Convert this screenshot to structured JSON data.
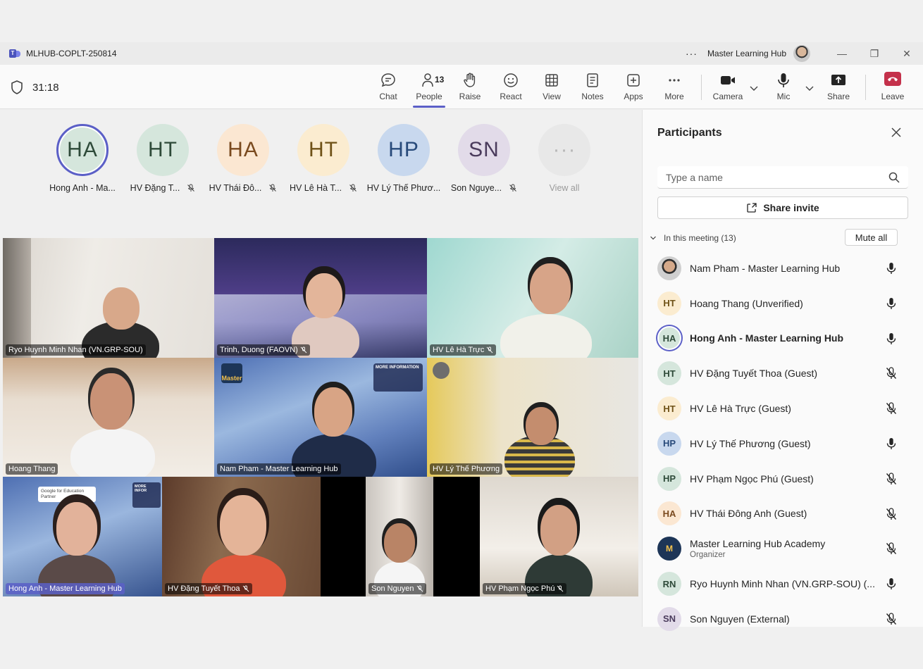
{
  "window": {
    "title": "MLHUB-COPLT-250814",
    "more_label": "···",
    "org_name": "Master Learning Hub",
    "minimize": "—",
    "restore": "❐",
    "close": "✕"
  },
  "toolbar": {
    "timer": "31:18",
    "people_count": "13",
    "items": [
      {
        "label": "Chat",
        "icon": "chat-icon"
      },
      {
        "label": "People",
        "icon": "people-icon"
      },
      {
        "label": "Raise",
        "icon": "hand-icon"
      },
      {
        "label": "React",
        "icon": "smile-icon"
      },
      {
        "label": "View",
        "icon": "grid-icon"
      },
      {
        "label": "Notes",
        "icon": "notes-icon"
      },
      {
        "label": "Apps",
        "icon": "plus-icon"
      },
      {
        "label": "More",
        "icon": "more-icon"
      },
      {
        "label": "Camera",
        "icon": "camera-icon"
      },
      {
        "label": "Mic",
        "icon": "mic-icon"
      },
      {
        "label": "Share",
        "icon": "share-icon"
      },
      {
        "label": "Leave",
        "icon": "phone-icon"
      }
    ],
    "active_tab": "People"
  },
  "avatar_strip": [
    {
      "initials": "HA",
      "label": "Hong Anh - Ma...",
      "muted": false,
      "speaking": true
    },
    {
      "initials": "HT",
      "label": "HV Đặng T...",
      "muted": true
    },
    {
      "initials": "HA",
      "label": "HV Thái Đô...",
      "muted": true
    },
    {
      "initials": "HT",
      "label": "HV Lê Hà T...",
      "muted": true
    },
    {
      "initials": "HP",
      "label": "HV Lý Thế Phươ...",
      "muted": false
    },
    {
      "initials": "SN",
      "label": "Son Nguye...",
      "muted": true
    },
    {
      "initials": "···",
      "label": "View all",
      "muted": false
    }
  ],
  "video_tiles": [
    {
      "name": "Ryo Huynh Minh Nhan (VN.GRP-SOU)",
      "muted": false
    },
    {
      "name": "Trinh, Duong (FAOVN)",
      "muted": true
    },
    {
      "name": "HV Lê Hà Trực",
      "muted": true
    },
    {
      "name": "Hoang Thang",
      "muted": false
    },
    {
      "name": "Nam Pham - Master Learning Hub",
      "muted": false
    },
    {
      "name": "HV Lý Thế Phương",
      "muted": false
    },
    {
      "name": "Hong Anh - Master Learning Hub",
      "muted": false
    },
    {
      "name": "HV Đặng Tuyết Thoa",
      "muted": true
    },
    {
      "name": "Son Nguyen",
      "muted": true
    },
    {
      "name": "HV Phạm Ngọc Phú",
      "muted": true
    }
  ],
  "tile_overlays": {
    "more_information": "MORE INFORMATION",
    "more_infor": "MORE INFOR",
    "google_partner_line1": "Google for Education",
    "google_partner_line2": "Partner",
    "master_logo": "Master"
  },
  "panel": {
    "title": "Participants",
    "search_placeholder": "Type a name",
    "share_invite": "Share invite",
    "section_label": "In this meeting (13)",
    "mute_all": "Mute all",
    "participants": [
      {
        "initials": "",
        "name": "Nam Pham - Master Learning Hub",
        "role": "",
        "mic": "on",
        "avatar": "photo"
      },
      {
        "initials": "HT",
        "name": "Hoang Thang (Unverified)",
        "role": "",
        "mic": "on",
        "avatar": "cream"
      },
      {
        "initials": "HA",
        "name": "Hong Anh - Master Learning Hub",
        "role": "",
        "mic": "on",
        "avatar": "green",
        "speaking": true
      },
      {
        "initials": "HT",
        "name": "HV Đặng Tuyết Thoa (Guest)",
        "role": "",
        "mic": "off",
        "avatar": "green"
      },
      {
        "initials": "HT",
        "name": "HV Lê Hà Trực (Guest)",
        "role": "",
        "mic": "off",
        "avatar": "cream"
      },
      {
        "initials": "HP",
        "name": "HV Lý Thế Phương (Guest)",
        "role": "",
        "mic": "on",
        "avatar": "blue"
      },
      {
        "initials": "HP",
        "name": "HV Phạm Ngọc Phú (Guest)",
        "role": "",
        "mic": "off",
        "avatar": "green"
      },
      {
        "initials": "HA",
        "name": "HV Thái Đông Anh (Guest)",
        "role": "",
        "mic": "off",
        "avatar": "peach"
      },
      {
        "initials": "M",
        "name": "Master Learning Hub Academy",
        "role": "Organizer",
        "mic": "off",
        "avatar": "logo"
      },
      {
        "initials": "RN",
        "name": "Ryo Huynh Minh Nhan (VN.GRP-SOU) (...",
        "role": "",
        "mic": "on",
        "avatar": "green"
      },
      {
        "initials": "SN",
        "name": "Son Nguyen (External)",
        "role": "",
        "mic": "off",
        "avatar": "lav"
      }
    ]
  },
  "colors": {
    "accent": "#5b5fc7",
    "leave": "#c4314b",
    "background": "#f0f0f0"
  }
}
